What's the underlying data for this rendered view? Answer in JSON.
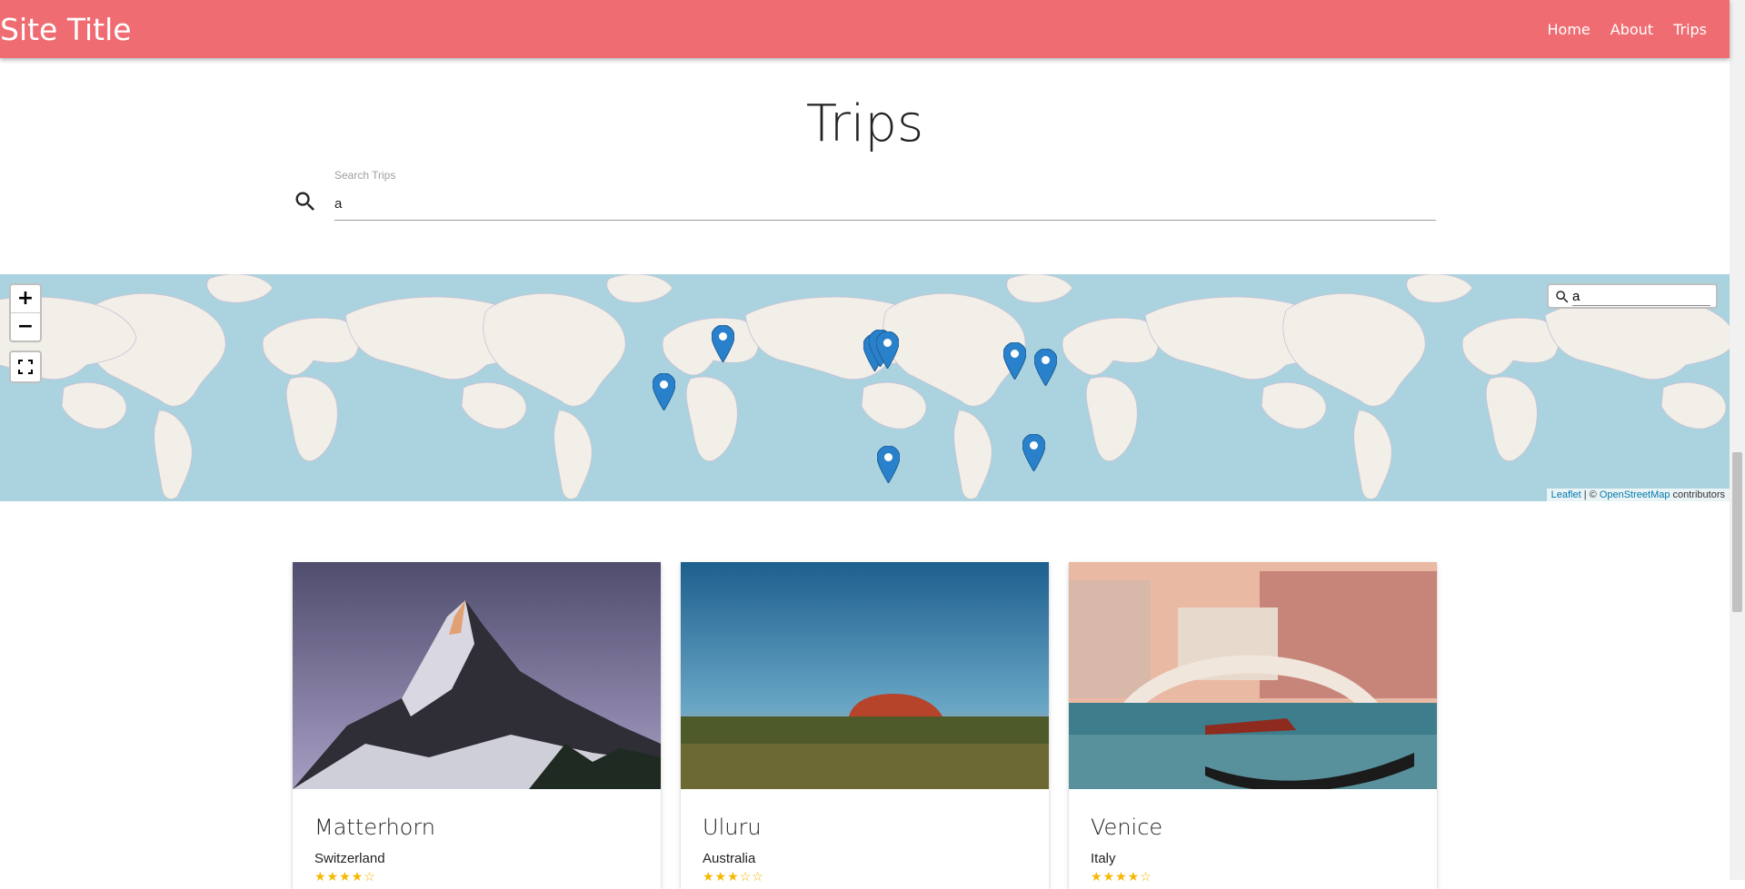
{
  "navbar": {
    "site_title": "Site Title",
    "links": [
      "Home",
      "About",
      "Trips"
    ],
    "background": "#ef6d72"
  },
  "page": {
    "title": "Trips"
  },
  "search": {
    "label": "Search Trips",
    "value": "a"
  },
  "map": {
    "search_value": "a",
    "zoom_in": "+",
    "zoom_out": "−",
    "attribution_leaflet": "Leaflet",
    "attribution_sep": " | © ",
    "attribution_osm": "OpenStreetMap",
    "attribution_suffix": " contributors",
    "marker_color": "#2a81cb",
    "marker_count": 9
  },
  "cards": [
    {
      "title": "Matterhorn",
      "country": "Switzerland",
      "rating": 4,
      "stars": "★★★★☆"
    },
    {
      "title": "Uluru",
      "country": "Australia",
      "rating": 3,
      "stars": "★★★☆☆"
    },
    {
      "title": "Venice",
      "country": "Italy",
      "rating": 4,
      "stars": "★★★★☆"
    }
  ]
}
